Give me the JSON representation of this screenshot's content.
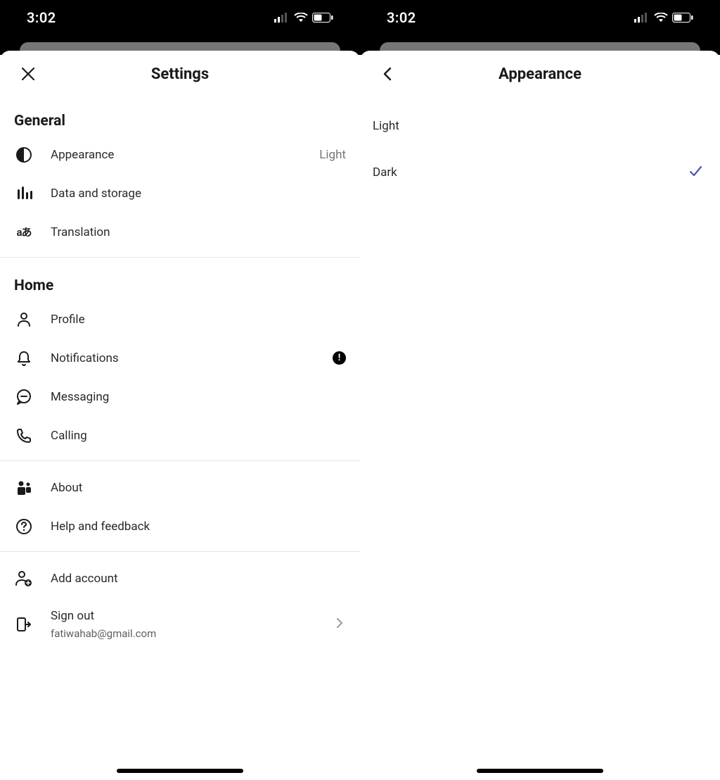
{
  "left": {
    "statusbar": {
      "time": "3:02"
    },
    "title": "Settings",
    "sections": {
      "general": {
        "title": "General",
        "appearance": {
          "label": "Appearance",
          "value": "Light"
        },
        "data_storage": {
          "label": "Data and storage"
        },
        "translation": {
          "label": "Translation"
        }
      },
      "home": {
        "title": "Home",
        "profile": {
          "label": "Profile"
        },
        "notifications": {
          "label": "Notifications",
          "badge": "!"
        },
        "messaging": {
          "label": "Messaging"
        },
        "calling": {
          "label": "Calling"
        }
      },
      "info": {
        "about": {
          "label": "About"
        },
        "help": {
          "label": "Help and feedback"
        }
      },
      "account": {
        "add_account": {
          "label": "Add account"
        },
        "sign_out": {
          "label": "Sign out",
          "email": "fatiwahab@gmail.com"
        }
      }
    }
  },
  "right": {
    "statusbar": {
      "time": "3:02"
    },
    "title": "Appearance",
    "options": {
      "light": {
        "label": "Light",
        "selected": false
      },
      "dark": {
        "label": "Dark",
        "selected": true
      }
    }
  }
}
